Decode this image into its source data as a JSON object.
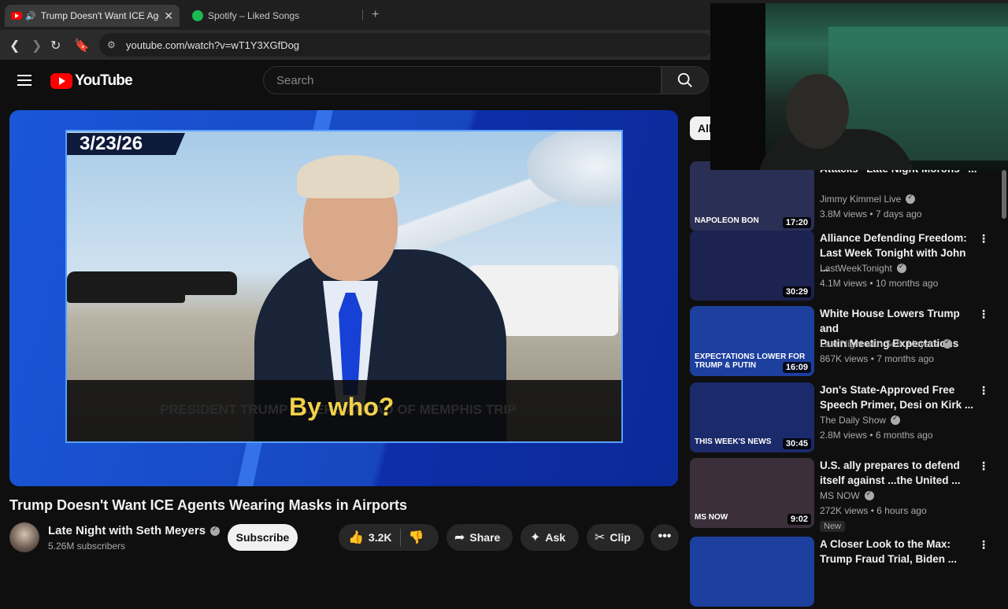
{
  "browser": {
    "tabs": [
      {
        "title": "Trump Doesn't Want ICE Agents Wearing Masks in Airports",
        "close": "✕"
      },
      {
        "title": "Spotify – Liked Songs"
      }
    ],
    "new_tab": "+",
    "url": "youtube.com/watch?v=wT1Y3XGfDog"
  },
  "youtube": {
    "logo_text": "YouTube",
    "search_placeholder": "Search"
  },
  "player": {
    "date_tag": "3/23/26",
    "ticker_text": "PRESIDENT TRUMP S... ERS AHEAD OF MEMPHIS TRIP",
    "subtitle": "By who?"
  },
  "video": {
    "title": "Trump Doesn't Want ICE Agents Wearing Masks in Airports",
    "channel": "Late Night with Seth Meyers",
    "subscribers": "5.26M subscribers",
    "subscribe_label": "Subscribe",
    "likes": "3.2K",
    "share_label": "Share",
    "ask_label": "Ask",
    "clip_label": "Clip",
    "more_label": "•••"
  },
  "sidebar": {
    "chip_all": "All",
    "recommendations": [
      {
        "title_l1": "Attacks “Late Night Morons” ...",
        "title_l2": "",
        "channel": "Jimmy Kimmel Live",
        "meta": "3.8M views • 7 days ago",
        "duration": "17:20",
        "caption": "NAPOLEON BON",
        "thumb_bg": "#2a2f55"
      },
      {
        "title_l1": "Alliance Defending Freedom:",
        "title_l2": "Last Week Tonight with John ...",
        "channel": "LastWeekTonight",
        "meta": "4.1M views • 10 months ago",
        "duration": "30:29",
        "caption": "",
        "thumb_bg": "#1c2350"
      },
      {
        "title_l1": "White House Lowers Trump and",
        "title_l2": "Putin Meeting Expectations",
        "channel": "Late Night with Seth Meyers",
        "meta": "867K views • 7 months ago",
        "duration": "16:09",
        "caption": "EXPECTATIONS LOWER FOR TRUMP & PUTIN",
        "thumb_bg": "#1d3f9e"
      },
      {
        "title_l1": "Jon's State-Approved Free",
        "title_l2": "Speech Primer, Desi on Kirk ...",
        "channel": "The Daily Show",
        "meta": "2.8M views • 6 months ago",
        "duration": "30:45",
        "caption": "THIS WEEK'S NEWS",
        "thumb_bg": "#1b2a6a"
      },
      {
        "title_l1": "U.S. ally prepares to defend",
        "title_l2": "itself against ...the United ...",
        "channel": "MS NOW",
        "meta": "272K views • 6 hours ago",
        "duration": "9:02",
        "caption": "MS NOW",
        "thumb_bg": "#3a2f3a",
        "badge": "New"
      },
      {
        "title_l1": "A Closer Look to the Max:",
        "title_l2": "Trump Fraud Trial, Biden ...",
        "channel": "",
        "meta": "",
        "duration": "",
        "caption": "",
        "thumb_bg": "#1d3f9e"
      }
    ],
    "more_icon": "⋮"
  }
}
